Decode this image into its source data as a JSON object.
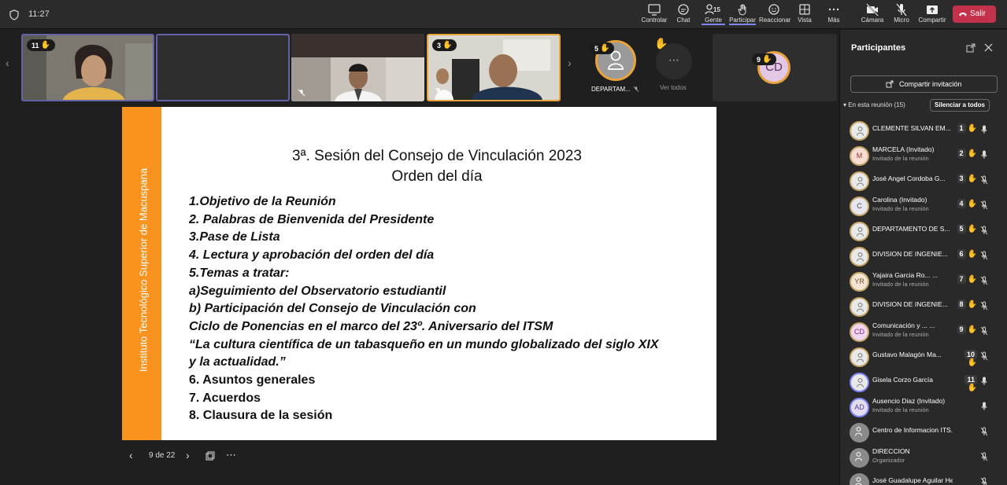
{
  "topbar": {
    "time": "11:27",
    "controls": [
      {
        "label": "Controlar",
        "icon": "monitor-icon"
      },
      {
        "label": "Chat",
        "icon": "chat-icon"
      },
      {
        "label": "Gente",
        "icon": "people-icon",
        "count": "15"
      },
      {
        "label": "Participar",
        "icon": "hand-raise-icon"
      },
      {
        "label": "Reaccionar",
        "icon": "emoji-icon"
      },
      {
        "label": "Vista",
        "icon": "grid-icon"
      },
      {
        "label": "Más",
        "icon": "more-icon"
      },
      {
        "label": "Cámara",
        "icon": "camera-off-icon"
      },
      {
        "label": "Micro",
        "icon": "mic-off-icon"
      },
      {
        "label": "Compartir",
        "icon": "share-tray-icon"
      }
    ],
    "leave_label": "Salir"
  },
  "strip": {
    "tiles": [
      {
        "badge": "11"
      },
      {
        "badge": ""
      },
      {
        "badge": ""
      },
      {
        "badge": "3"
      }
    ],
    "extra": [
      {
        "badge": "5",
        "label": "DEPARTAM..."
      },
      {
        "label": "Ver todos"
      },
      {
        "badge": "9",
        "initials": "CD"
      }
    ]
  },
  "slide": {
    "side_text": "Instituto Tecnológico Superior de Macuspana",
    "title_line1": "3ª. Sesión del Consejo de Vinculación 2023",
    "title_line2": "Orden del día",
    "agenda": [
      "1.Objetivo de la Reunión",
      "2. Palabras de Bienvenida del  Presidente",
      "3.Pase de Lista",
      "4. Lectura  y aprobación del orden del día",
      "5.Temas a tratar:",
      "a)Seguimiento del Observatorio estudiantil",
      "b) Participación del Consejo de Vinculación con",
      "Ciclo de Ponencias en el marco del 23º. Aniversario del ITSM",
      "“La cultura científica de un tabasqueño en un mundo globalizado del siglo XIX",
      "y la actualidad.”",
      "6. Asuntos generales",
      "7. Acuerdos",
      "8. Clausura de la sesión"
    ],
    "page": "9 de 22"
  },
  "panel": {
    "title": "Participantes",
    "share_label": "Compartir invitación",
    "in_meeting": "En esta reunión (15)",
    "mute_all": "Silenciar a todos",
    "participants": [
      {
        "name": "CLEMENTE SILVAN EM...",
        "sub": "",
        "hand": "1",
        "initials": "",
        "muted": false
      },
      {
        "name": "MARCELA (Invitado)",
        "sub": "Invitado de la reunión",
        "hand": "2",
        "initials": "M",
        "muted": false
      },
      {
        "name": "José Angel Cordoba G...",
        "sub": "",
        "hand": "3",
        "initials": "",
        "muted": true
      },
      {
        "name": "Carolina (Invitado)",
        "sub": "Invitado de la reunión",
        "hand": "4",
        "initials": "C",
        "muted": true
      },
      {
        "name": "DEPARTAMENTO DE S...",
        "sub": "",
        "hand": "5",
        "initials": "",
        "muted": true
      },
      {
        "name": "DIVISION DE INGENIE...",
        "sub": "",
        "hand": "6",
        "initials": "",
        "muted": true
      },
      {
        "name": "Yajaira Garcia Ro... ...",
        "sub": "Invitado de la reunión",
        "hand": "7",
        "initials": "YR",
        "muted": true
      },
      {
        "name": "DIVISION DE INGENIE...",
        "sub": "",
        "hand": "8",
        "initials": "",
        "muted": true
      },
      {
        "name": "Comunicación y ... ...",
        "sub": "Invitado de la reunión",
        "hand": "9",
        "initials": "CD",
        "muted": true
      },
      {
        "name": "Gustavo Malagón Ma...",
        "sub": "",
        "hand": "10",
        "initials": "",
        "muted": true
      },
      {
        "name": "Gisela Corzo García",
        "sub": "",
        "hand": "11",
        "initials": "",
        "muted": false
      },
      {
        "name": "Ausencio Diaz (Invitado)",
        "sub": "Invitado de la reunión",
        "hand": "",
        "initials": "AD",
        "muted": false
      },
      {
        "name": "Centro de Informacion ITS. M...",
        "sub": "",
        "hand": "",
        "initials": "",
        "muted": true
      },
      {
        "name": "DIRECCION",
        "sub": "Organizador",
        "hand": "",
        "initials": "",
        "muted": true
      },
      {
        "name": "José Guadalupe Aguilar Hern...",
        "sub": "",
        "hand": "",
        "initials": "",
        "muted": true
      }
    ]
  }
}
